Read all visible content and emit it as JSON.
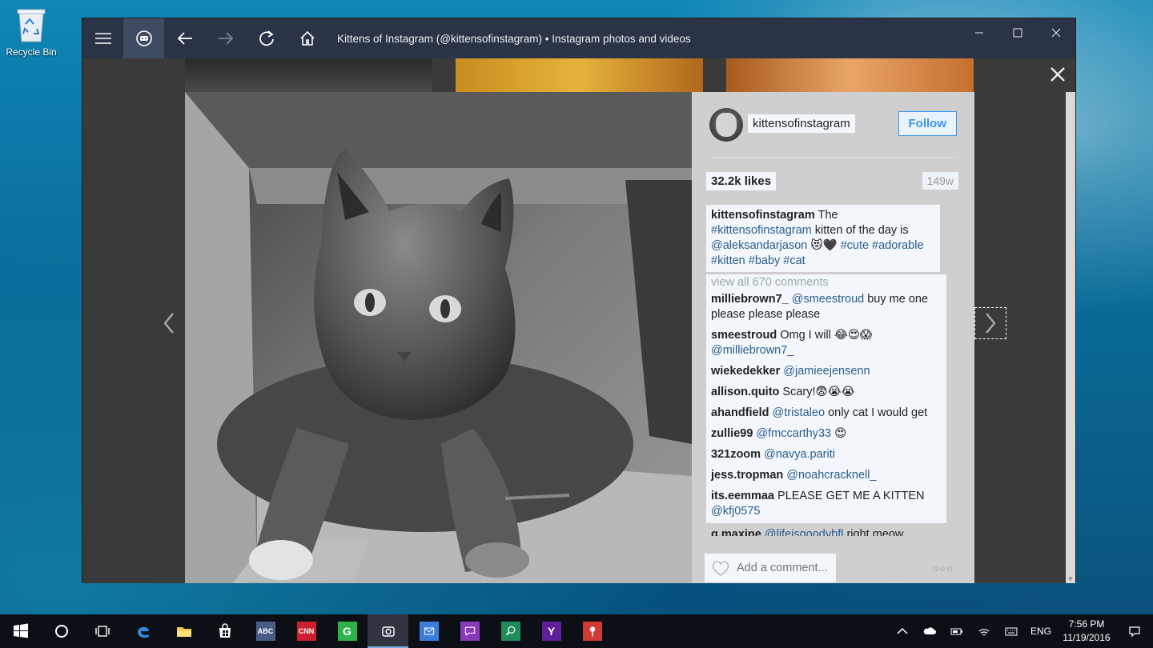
{
  "desktop": {
    "recycle_bin_label": "Recycle Bin"
  },
  "window": {
    "title": "Kittens of Instagram (@kittensofinstagram) • Instagram photos and videos",
    "buttons": [
      "menu-icon",
      "bot-icon",
      "back-icon",
      "forward-icon",
      "refresh-icon",
      "home-icon"
    ]
  },
  "post": {
    "username": "kittensofinstagram",
    "follow_label": "Follow",
    "likes": "32.2k likes",
    "age": "149w",
    "caption": {
      "user": "kittensofinstagram",
      "text_1": " The ",
      "tag_1": "#kittensofinstagram",
      "text_2": " kitten of the day is ",
      "tag_2": "@aleksandarjason",
      "text_3": " 😻🖤 ",
      "tag_3": "#cute #adorable",
      "tag_4": "#kitten #baby #cat"
    },
    "view_all": "view all 670 comments",
    "comments": [
      {
        "user": "milliebrown7_",
        "mention": "@smeestroud",
        "text": " buy me one please please please"
      },
      {
        "user": "smeestroud",
        "mention": "",
        "text": " Omg I will 😂😍😱",
        "mention_after": "@milliebrown7_"
      },
      {
        "user": "wiekedekker",
        "mention": "@jamieejensenn",
        "text": ""
      },
      {
        "user": "allison.quito",
        "mention": "",
        "text": " Scary!😨😭😭"
      },
      {
        "user": "ahandfield",
        "mention": "@tristaleo",
        "text": " only cat I would get"
      },
      {
        "user": "zullie99",
        "mention": "@fmccarthy33",
        "text": " 😍"
      },
      {
        "user": "321zoom",
        "mention": "@navya.pariti",
        "text": ""
      },
      {
        "user": "jess.tropman",
        "mention": "@noahcracknell_",
        "text": ""
      },
      {
        "user": "its.eemmaa",
        "mention": "",
        "text": " PLEASE GET ME A KITTEN",
        "mention_after": "@kfj0575"
      }
    ],
    "cutoff_user": "g.maxine",
    "cutoff_mention": "@lifeisgoodybfl",
    "cutoff_text": " right meow",
    "add_comment_placeholder": "Add a comment...",
    "more_label": "ooo"
  },
  "taskbar": {
    "apps": [
      "ABC",
      "CNN",
      "G"
    ],
    "lang": "ENG",
    "time": "7:56 PM",
    "date": "11/19/2016"
  }
}
